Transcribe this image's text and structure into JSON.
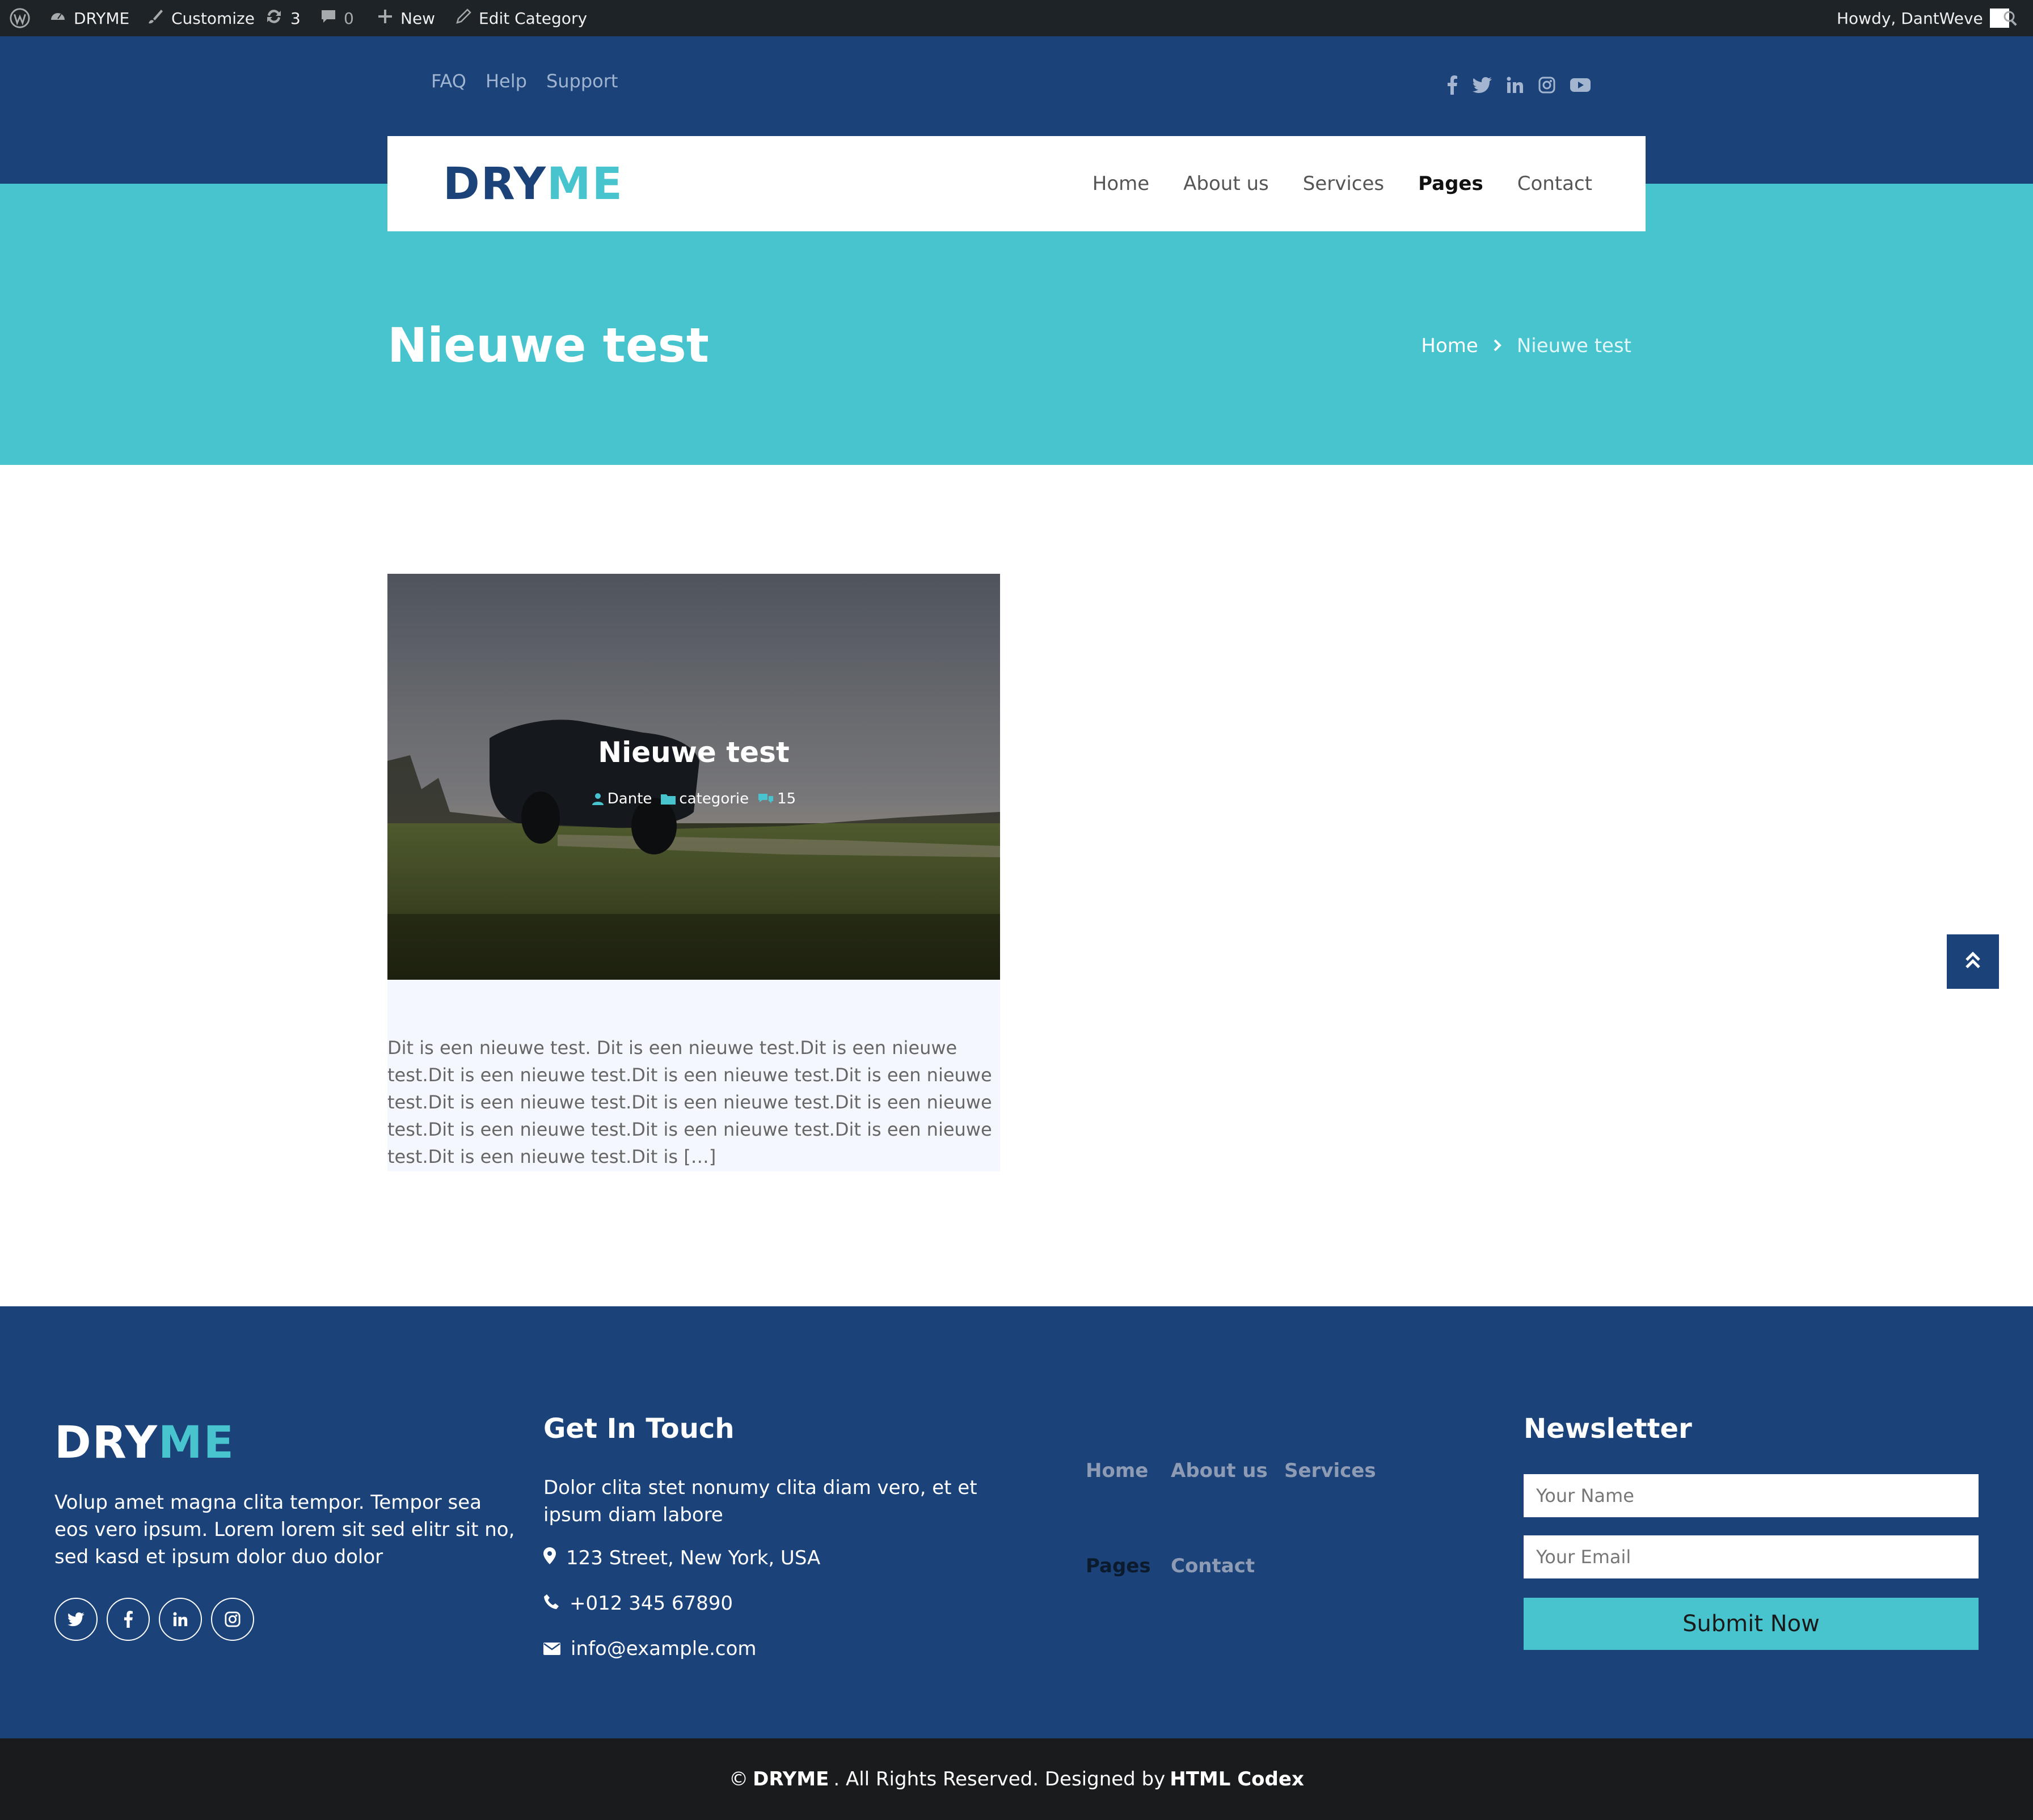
{
  "admin_bar": {
    "site_name": "DRYME",
    "customize": "Customize",
    "updates_count": "3",
    "comments_count": "0",
    "new_label": "New",
    "edit_label": "Edit Category",
    "greeting": "Howdy, DantWeve"
  },
  "top_links": [
    "FAQ",
    "Help",
    "Support"
  ],
  "brand": {
    "part1": "DRY",
    "part2": "ME"
  },
  "nav": {
    "home": "Home",
    "about": "About us",
    "services": "Services",
    "pages": "Pages",
    "contact": "Contact"
  },
  "hero": {
    "title": "Nieuwe test",
    "breadcrumb_home": "Home",
    "breadcrumb_current": "Nieuwe test"
  },
  "post": {
    "title": "Nieuwe test",
    "author": "Dante",
    "category": "categorie",
    "comments": "15",
    "excerpt": "Dit is een nieuwe test. Dit is een nieuwe test.Dit is een nieuwe test.Dit is een nieuwe test.Dit is een nieuwe test.Dit is een nieuwe test.Dit is een nieuwe test.Dit is een nieuwe test.Dit is een nieuwe test.Dit is een nieuwe test.Dit is een nieuwe test.Dit is een nieuwe test.Dit is een nieuwe test.Dit is […]"
  },
  "footer": {
    "about_text": "Volup amet magna clita tempor. Tempor sea eos vero ipsum. Lorem lorem sit sed elitr sit no, sed kasd et ipsum dolor duo dolor",
    "touch_heading": "Get In Touch",
    "touch_text": "Dolor clita stet nonumy clita diam vero, et et ipsum diam labore",
    "address": "123 Street, New York, USA",
    "phone": "+012 345 67890",
    "email": "info@example.com",
    "links": {
      "home": "Home",
      "about": "About us",
      "services": "Services",
      "pages": "Pages",
      "contact": "Contact"
    },
    "newsletter_heading": "Newsletter",
    "name_placeholder": "Your Name",
    "email_placeholder": "Your Email",
    "submit_label": "Submit Now"
  },
  "copyright": {
    "prefix": "©",
    "brand": "DRYME",
    "middle": ". All Rights Reserved. Designed by",
    "designer": "HTML Codex"
  },
  "colors": {
    "navy": "#1b4379",
    "teal": "#48c4cf",
    "admin_bar": "#1d2327",
    "copyright_bg": "#1a1b1d"
  }
}
